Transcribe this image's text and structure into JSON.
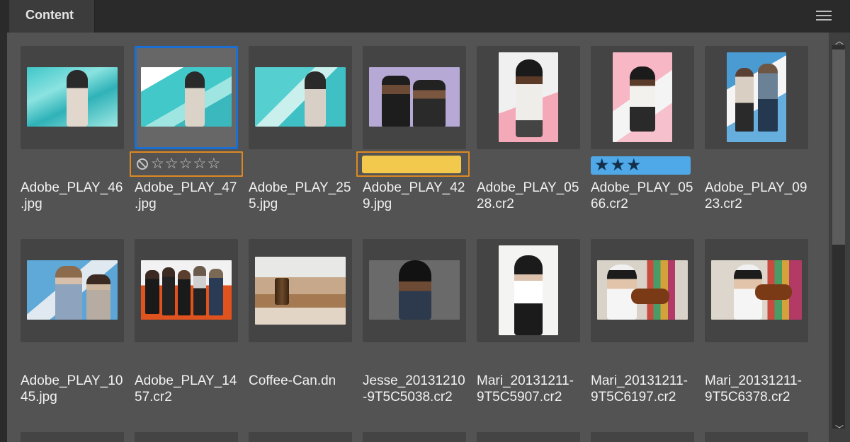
{
  "panel": {
    "tab_label": "Content",
    "menu_icon": "hamburger-menu-icon"
  },
  "colors": {
    "selection": "#1c6fd2",
    "focus_outline": "#dd8922",
    "label_yellow": "#f2c94c",
    "label_blue": "#4fa8e8"
  },
  "rows": [
    {
      "items": [
        {
          "filename": "Adobe_PLAY_46\n.jpg"
        },
        {
          "filename": "Adobe_PLAY_47\n.jpg",
          "selected": true,
          "rating": 0,
          "rejected_icon": "reject-icon",
          "rating_visible": true
        },
        {
          "filename": "Adobe_PLAY_25\n5.jpg"
        },
        {
          "filename": "Adobe_PLAY_42\n9.jpg",
          "label": "yellow"
        },
        {
          "filename": "Adobe_PLAY_05\n28.cr2"
        },
        {
          "filename": "Adobe_PLAY_05\n66.cr2",
          "label": "blue",
          "rating": 3
        },
        {
          "filename": "Adobe_PLAY_09\n23.cr2"
        }
      ]
    },
    {
      "items": [
        {
          "filename": "Adobe_PLAY_10\n45.jpg"
        },
        {
          "filename": "Adobe_PLAY_14\n57.cr2"
        },
        {
          "filename": "Coffee-Can.dn"
        },
        {
          "filename": "Jesse_20131210\n-9T5C5038.cr2"
        },
        {
          "filename": "Mari_20131211-\n9T5C5907.cr2"
        },
        {
          "filename": "Mari_20131211-\n9T5C6197.cr2"
        },
        {
          "filename": "Mari_20131211-\n9T5C6378.cr2"
        }
      ]
    }
  ]
}
